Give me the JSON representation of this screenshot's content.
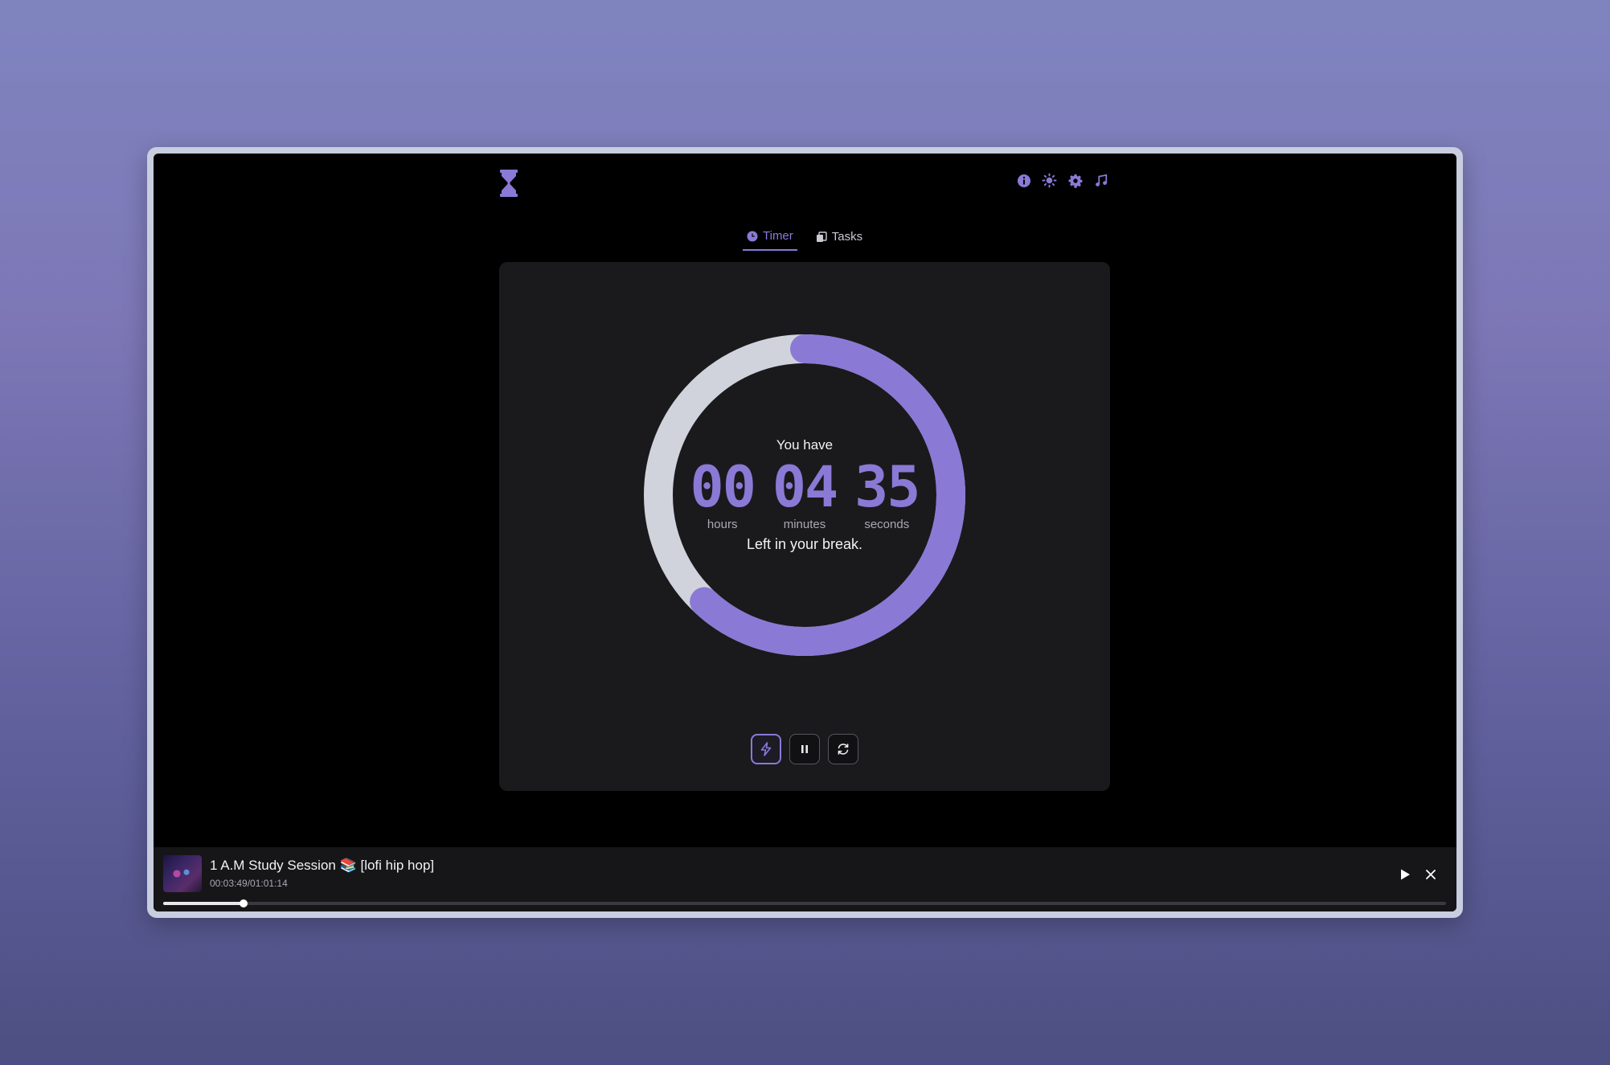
{
  "nav": {
    "tabs": [
      {
        "label": "Timer",
        "icon": "clock-icon",
        "active": true
      },
      {
        "label": "Tasks",
        "icon": "clipboard-icon",
        "active": false
      }
    ],
    "icons": [
      "info-icon",
      "sun-icon",
      "gear-icon",
      "music-note-icon"
    ]
  },
  "timer": {
    "heading": "You have",
    "hours": "00",
    "minutes": "04",
    "seconds": "35",
    "hours_label": "hours",
    "minutes_label": "minutes",
    "seconds_label": "seconds",
    "footer": "Left in your break.",
    "remaining_fraction": 0.62
  },
  "controls": [
    "lightning-icon",
    "pause-icon",
    "refresh-icon"
  ],
  "player": {
    "title": "1 A.M Study Session 📚 [lofi hip hop]",
    "time": "00:03:49/01:01:14",
    "progress": 0.0624
  },
  "colors": {
    "accent": "#8b79d6",
    "ring_track": "#d0d3db",
    "card": "#1a1a1d"
  }
}
